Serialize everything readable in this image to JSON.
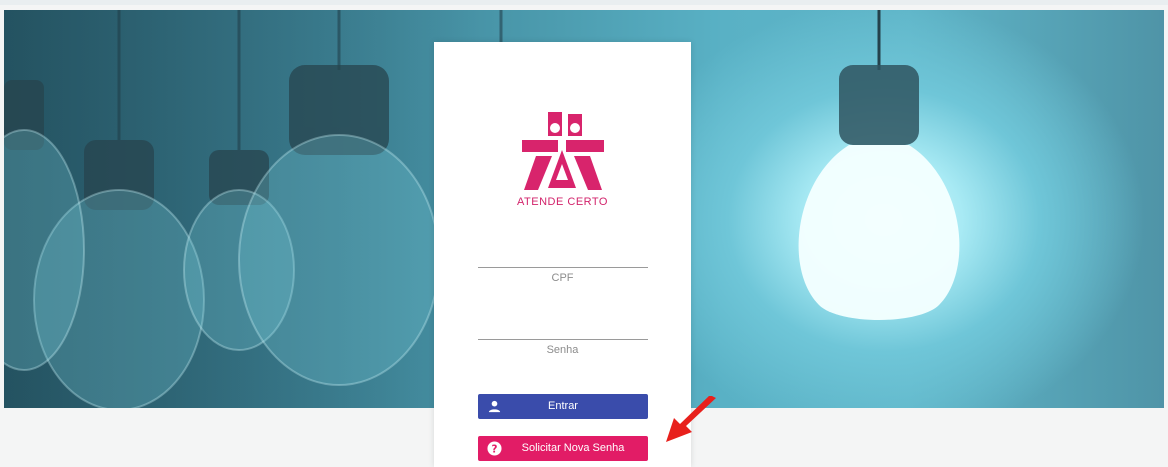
{
  "brand": {
    "name": "ATENDE CERTO",
    "color": "#d2236b"
  },
  "login_form": {
    "cpf_label": "CPF",
    "cpf_value": "",
    "password_label": "Senha",
    "password_value": "",
    "login_button": {
      "label": "Entrar",
      "icon": "user-icon",
      "color": "#3a4cab"
    },
    "reset_button": {
      "label": "Solicitar Nova Senha",
      "icon": "question-circle-icon",
      "color": "#e21c66"
    }
  },
  "annotation": {
    "icon": "red-arrow-icon",
    "color": "#e8201c"
  }
}
